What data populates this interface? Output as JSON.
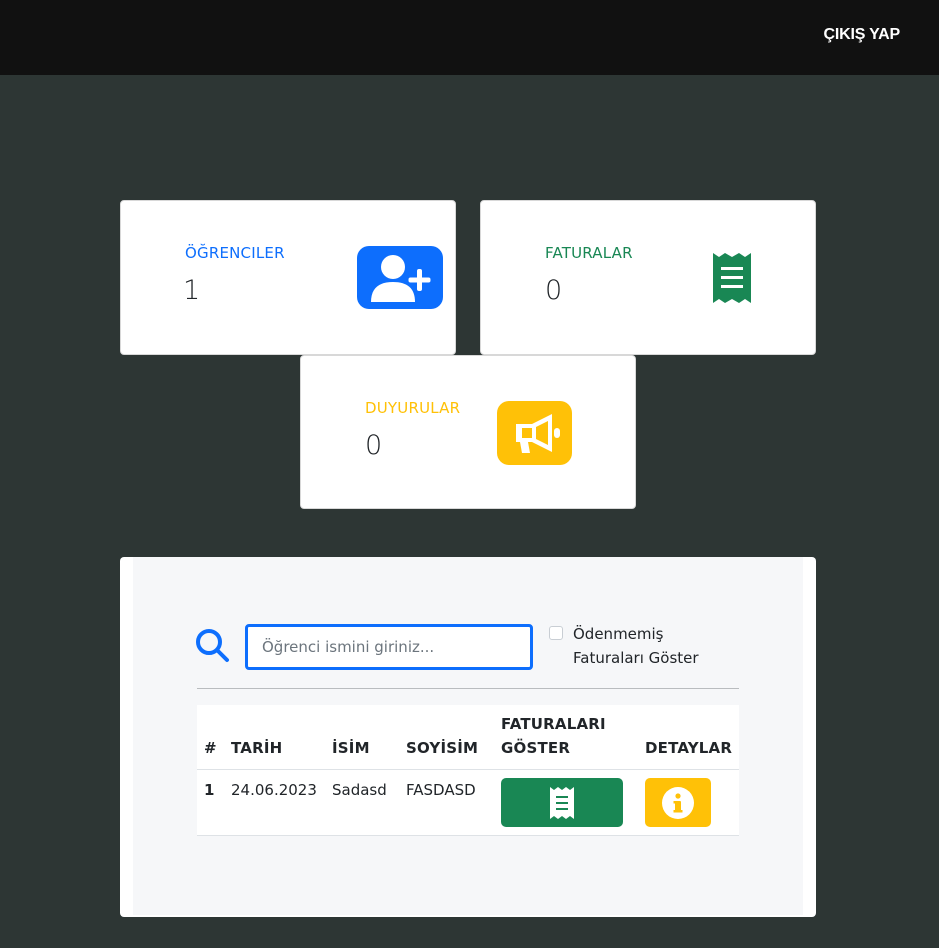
{
  "header": {
    "logout_label": "ÇIKIŞ YAP"
  },
  "stats": {
    "students": {
      "label": "ÖĞRENCILER",
      "value": "1",
      "color": "#0d6efd",
      "icon": "user-plus-icon"
    },
    "invoices": {
      "label": "FATURALAR",
      "value": "0",
      "color": "#198754",
      "icon": "receipt-icon"
    },
    "announcements": {
      "label": "DUYURULAR",
      "value": "0",
      "color": "#ffc107",
      "icon": "megaphone-icon"
    }
  },
  "search": {
    "placeholder": "Öğrenci ismini giriniz...",
    "value": "",
    "unpaid_checkbox_label": "Ödenmemiş Faturaları Göster",
    "unpaid_checked": false
  },
  "table": {
    "columns": [
      "#",
      "TARİH",
      "İSİM",
      "SOYİSİM",
      "FATURALARI GÖSTER",
      "DETAYLAR"
    ],
    "rows": [
      {
        "index": "1",
        "date": "24.06.2023",
        "name": "Sadasd",
        "surname": "FASDASD"
      }
    ]
  }
}
